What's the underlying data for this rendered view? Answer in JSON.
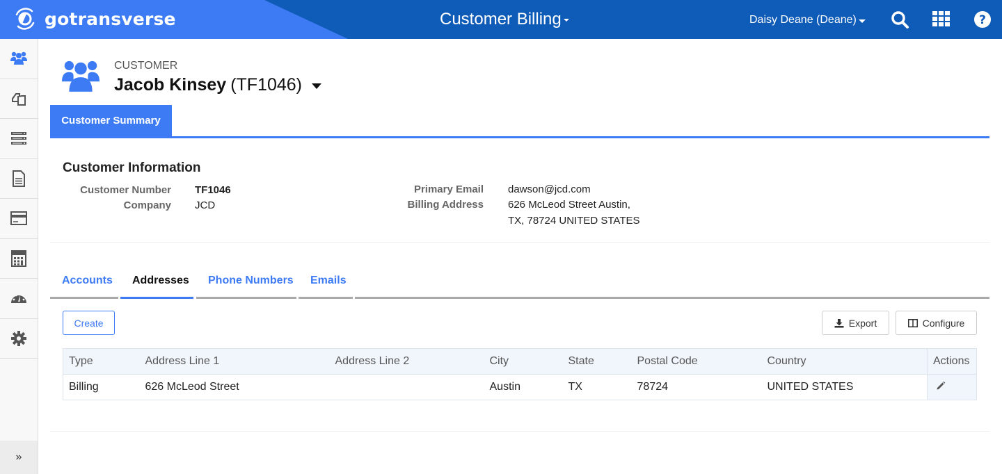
{
  "topbar": {
    "brand": "gotransverse",
    "app_title": "Customer Billing",
    "user": "Daisy Deane (Deane)",
    "icons": [
      "search-icon",
      "apps-grid-icon",
      "help-icon"
    ]
  },
  "rail": {
    "items": [
      {
        "icon": "customers-icon",
        "active": true
      },
      {
        "icon": "documents-icon"
      },
      {
        "icon": "server-list-icon"
      },
      {
        "icon": "file-text-icon"
      },
      {
        "icon": "credit-card-icon"
      },
      {
        "icon": "calculator-icon"
      },
      {
        "icon": "dashboard-gauge-icon"
      },
      {
        "icon": "settings-gear-icon"
      }
    ],
    "expand_label": "»"
  },
  "customer": {
    "label": "CUSTOMER",
    "name": "Jacob Kinsey",
    "id": "(TF1046)"
  },
  "summary_tab": "Customer Summary",
  "info": {
    "title": "Customer Information",
    "customer_number_label": "Customer Number",
    "customer_number": "TF1046",
    "company_label": "Company",
    "company": "JCD",
    "primary_email_label": "Primary Email",
    "primary_email": "dawson@jcd.com",
    "billing_address_label": "Billing Address",
    "billing_address_line1": "626 McLeod Street Austin,",
    "billing_address_line2": "TX, 78724 UNITED STATES"
  },
  "tabs": [
    {
      "label": "Accounts",
      "active": false
    },
    {
      "label": "Addresses",
      "active": true
    },
    {
      "label": "Phone Numbers",
      "active": false
    },
    {
      "label": "Emails",
      "active": false
    }
  ],
  "toolbar": {
    "create_label": "Create",
    "export_label": "Export",
    "configure_label": "Configure"
  },
  "table": {
    "columns": [
      "Type",
      "Address Line 1",
      "Address Line 2",
      "City",
      "State",
      "Postal Code",
      "Country",
      "Actions"
    ],
    "rows": [
      {
        "type": "Billing",
        "line1": "626 McLeod Street",
        "line2": "",
        "city": "Austin",
        "state": "TX",
        "postal": "78724",
        "country": "UNITED STATES"
      }
    ]
  },
  "colors": {
    "brand_blue": "#3d7bf5",
    "header_dark_blue": "#0f5bb8"
  }
}
